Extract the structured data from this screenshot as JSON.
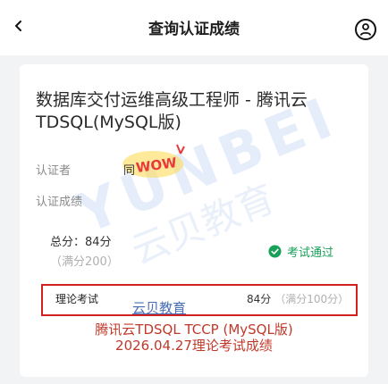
{
  "header": {
    "title": "查询认证成绩",
    "back_icon": "chevron-left-icon",
    "help_icon": "help-circle-icon"
  },
  "card": {
    "course_title": "数据库交付运维高级工程师 - 腾讯云TDSQL(MySQL版)",
    "certifier_label": "认证者",
    "certifier_value": "同",
    "result_label": "认证成绩",
    "total_score": "总分：84分",
    "full_score": "（满分200）",
    "status": "考试通过",
    "status_color": "#18a058",
    "theory_label": "理论考试",
    "theory_score": "84分",
    "theory_full": "（满分100分）"
  },
  "annotations": {
    "highlight_color": "#d02020",
    "line1": "腾讯云TDSQL TCCP (MySQL版)",
    "line2": "2026.04.27理论考试成绩"
  },
  "watermark": {
    "brand_text": "YUNBEI",
    "cn_text": "云贝教育",
    "edu_text": "云贝教育",
    "sticker_text": "WOW"
  }
}
